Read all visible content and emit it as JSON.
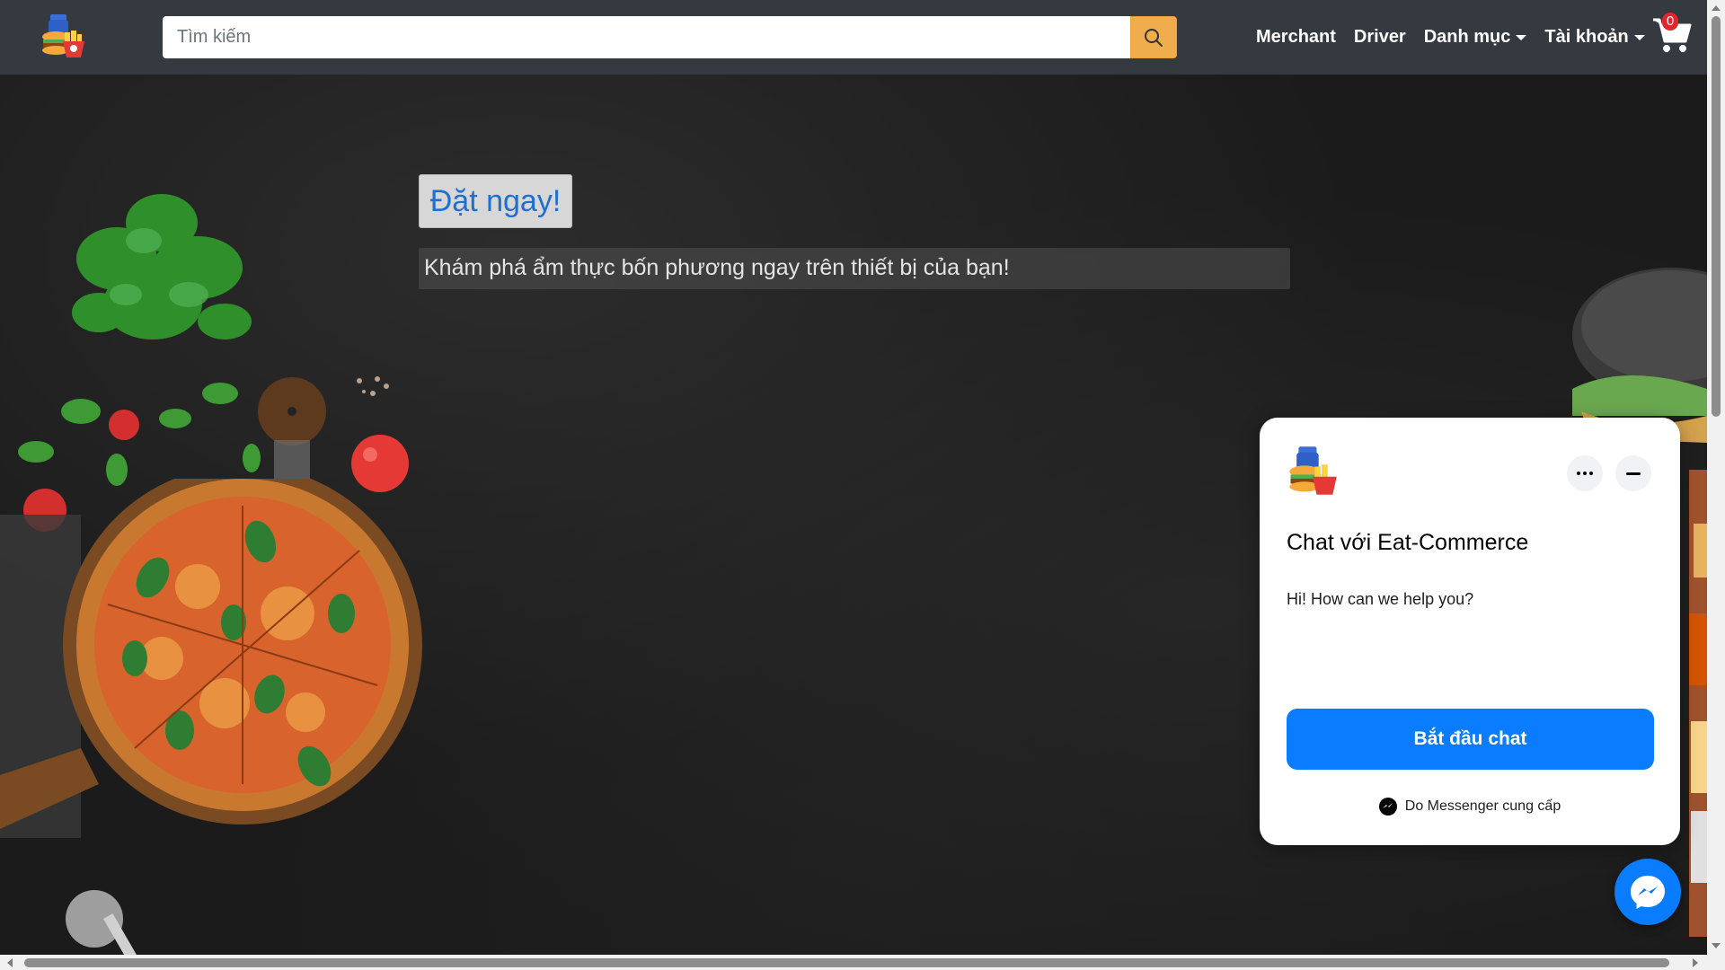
{
  "navbar": {
    "logo_icon": "food-logo-icon",
    "search": {
      "placeholder": "Tìm kiếm",
      "value": ""
    },
    "links": {
      "merchant": "Merchant",
      "driver": "Driver",
      "category": "Danh mục",
      "account": "Tài khoản"
    },
    "cart_count": "0",
    "colors": {
      "bar": "#343a40",
      "search_button": "#f0ad4e",
      "badge": "#e3262c"
    }
  },
  "hero": {
    "cta_label": "Đặt ngay!",
    "subtitle": "Khám phá ẩm thực bốn phương ngay trên thiết bị của bạn!"
  },
  "chat": {
    "title": "Chat với Eat-Commerce",
    "message": "Hi! How can we help you?",
    "start_label": "Bắt đầu chat",
    "powered_by": "Do Messenger cung cấp",
    "accent": "#0a7cff"
  }
}
